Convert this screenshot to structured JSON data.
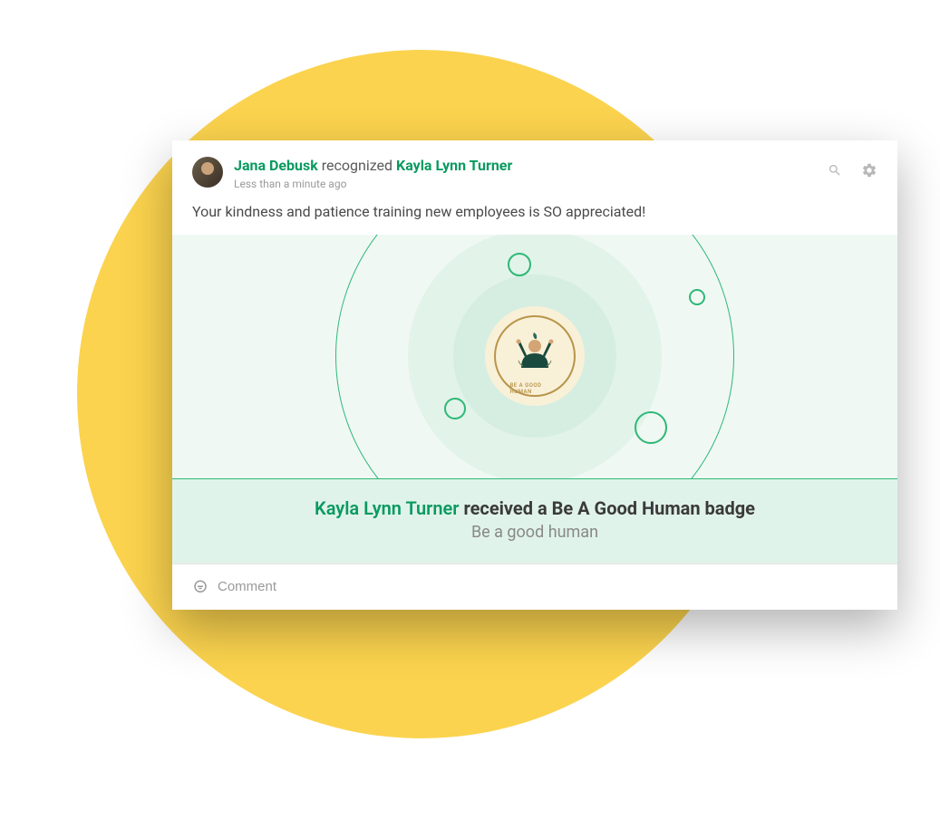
{
  "header": {
    "actor": "Jana Debusk",
    "verb": "recognized",
    "recipient": "Kayla Lynn Turner",
    "timestamp": "Less than a minute ago"
  },
  "message": "Your kindness and patience training new employees is SO appreciated!",
  "badge": {
    "badge_title": "Be A Good Human",
    "inner_text": "BE A GOOD HUMAN"
  },
  "banner": {
    "recipient": "Kayla Lynn Turner",
    "text": "received a Be A Good Human badge",
    "subtitle": "Be a good human"
  },
  "comment": {
    "placeholder": "Comment"
  },
  "colors": {
    "accent": "#099a5f",
    "bubble_yellow": "#fbd34e",
    "ring_green": "#2eb876"
  }
}
